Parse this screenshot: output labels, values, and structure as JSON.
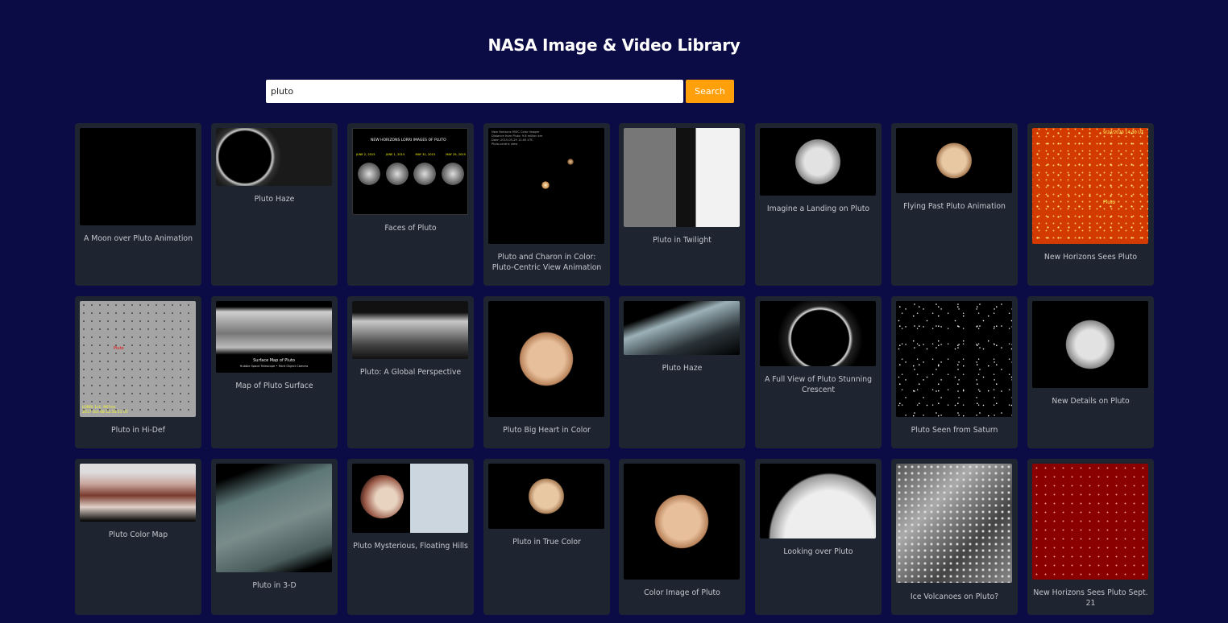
{
  "header": {
    "title": "NASA Image & Video Library"
  },
  "search": {
    "value": "pluto",
    "button_label": "Search"
  },
  "results": [
    {
      "caption": "A Moon over Pluto Animation"
    },
    {
      "caption": "Pluto Haze"
    },
    {
      "caption": "Faces of Pluto"
    },
    {
      "caption": "Pluto and Charon in Color: Pluto-Centric View Animation"
    },
    {
      "caption": "Pluto in Twilight"
    },
    {
      "caption": "Imagine a Landing on Pluto"
    },
    {
      "caption": "Flying Past Pluto Animation"
    },
    {
      "caption": "New Horizons Sees Pluto"
    },
    {
      "caption": "Pluto in Hi-Def"
    },
    {
      "caption": "Map of Pluto Surface"
    },
    {
      "caption": "Pluto: A Global Perspective"
    },
    {
      "caption": "Pluto Big Heart in Color"
    },
    {
      "caption": "Pluto Haze"
    },
    {
      "caption": "A Full View of Pluto Stunning Crescent"
    },
    {
      "caption": "Pluto Seen from Saturn"
    },
    {
      "caption": "New Details on Pluto"
    },
    {
      "caption": "Pluto Color Map"
    },
    {
      "caption": "Pluto in 3-D"
    },
    {
      "caption": "Pluto Mysterious, Floating Hills"
    },
    {
      "caption": "Pluto in True Color"
    },
    {
      "caption": "Color Image of Pluto"
    },
    {
      "caption": "Looking over Pluto"
    },
    {
      "caption": "Ice Volcanoes on Pluto?"
    },
    {
      "caption": "New Horizons Sees Pluto Sept. 21"
    }
  ],
  "thumb_text": {
    "faces_title": "NEW HORIZONS LORRI IMAGES OF PLUTO",
    "faces_dates": [
      "JUNE 2, 2015",
      "JUNE 1, 2015",
      "MAY 31, 2015",
      "MAY 29, 2015"
    ],
    "hubble_title": "Surface Map of Pluto",
    "hubble_sub": "Hubble Space Telescope • Faint Object Camera",
    "nh_stamp": "9/24/2020 14:30 UT",
    "nh_label": "Pluto",
    "hidef_label": "Pluto",
    "hidef_stamp": "LORRI 1x1, 967ms",
    "hidef_date": "2017 Oct 08 12:50:51 UT",
    "mvic_lines": [
      "New Horizons MVIC Color Imager",
      "Distance from Pluto: 9.8 million km",
      "Date: 2015-05-29 11:00 UTC",
      "Pluto-centric view"
    ]
  }
}
